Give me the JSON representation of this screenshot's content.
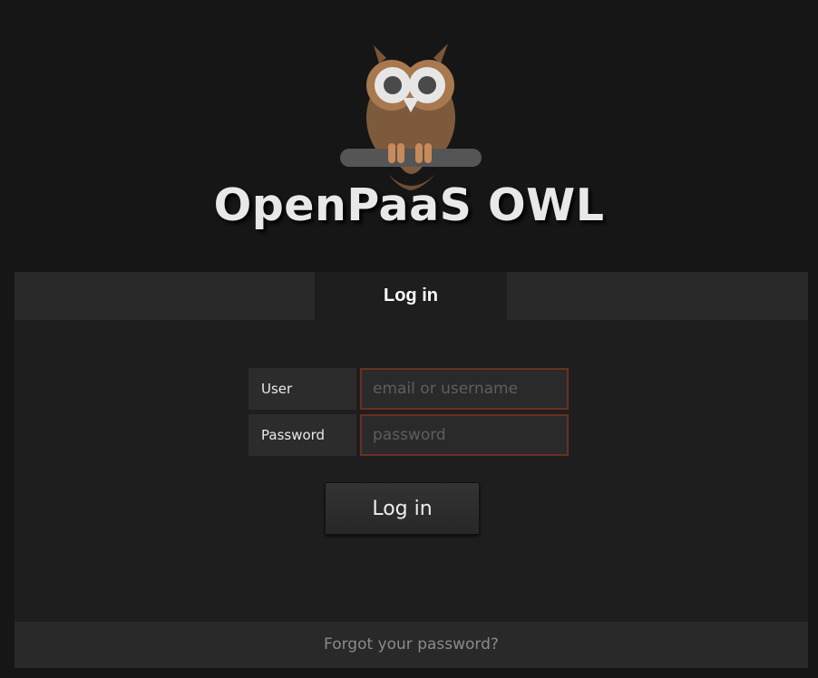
{
  "app": {
    "title": "OpenPaaS OWL"
  },
  "tabs": {
    "active_label": "Log in"
  },
  "form": {
    "user_label": "User",
    "user_value": "",
    "user_placeholder": "email or username",
    "password_label": "Password",
    "password_value": "",
    "password_placeholder": "password",
    "submit_label": "Log in"
  },
  "footer": {
    "forgot_label": "Forgot your password?"
  },
  "icons": {
    "logo": "owl-logo-icon"
  },
  "colors": {
    "background": "#161616",
    "panel": "#1f1e1e",
    "strip": "#292929",
    "input_border": "#6b2f20",
    "owl_body": "#7e5a3c",
    "owl_face": "#a8784e",
    "branch": "#555555"
  }
}
